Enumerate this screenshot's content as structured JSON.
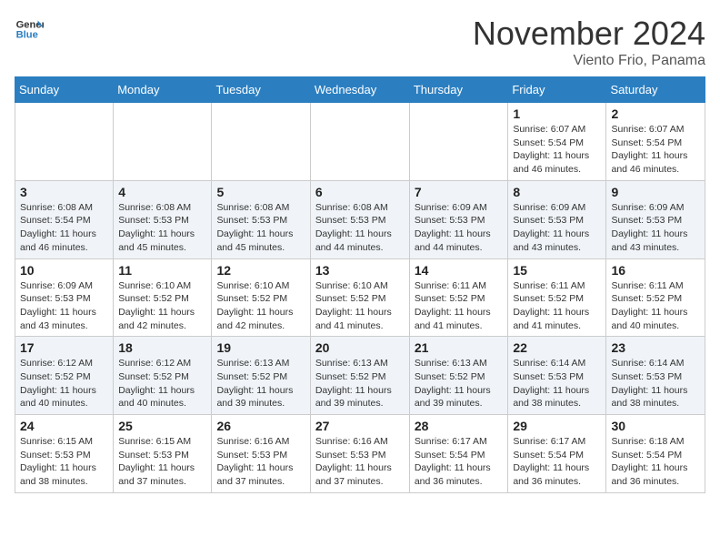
{
  "header": {
    "logo_line1": "General",
    "logo_line2": "Blue",
    "month_title": "November 2024",
    "location": "Viento Frio, Panama"
  },
  "weekdays": [
    "Sunday",
    "Monday",
    "Tuesday",
    "Wednesday",
    "Thursday",
    "Friday",
    "Saturday"
  ],
  "weeks": [
    [
      {
        "day": "",
        "info": ""
      },
      {
        "day": "",
        "info": ""
      },
      {
        "day": "",
        "info": ""
      },
      {
        "day": "",
        "info": ""
      },
      {
        "day": "",
        "info": ""
      },
      {
        "day": "1",
        "info": "Sunrise: 6:07 AM\nSunset: 5:54 PM\nDaylight: 11 hours\nand 46 minutes."
      },
      {
        "day": "2",
        "info": "Sunrise: 6:07 AM\nSunset: 5:54 PM\nDaylight: 11 hours\nand 46 minutes."
      }
    ],
    [
      {
        "day": "3",
        "info": "Sunrise: 6:08 AM\nSunset: 5:54 PM\nDaylight: 11 hours\nand 46 minutes."
      },
      {
        "day": "4",
        "info": "Sunrise: 6:08 AM\nSunset: 5:53 PM\nDaylight: 11 hours\nand 45 minutes."
      },
      {
        "day": "5",
        "info": "Sunrise: 6:08 AM\nSunset: 5:53 PM\nDaylight: 11 hours\nand 45 minutes."
      },
      {
        "day": "6",
        "info": "Sunrise: 6:08 AM\nSunset: 5:53 PM\nDaylight: 11 hours\nand 44 minutes."
      },
      {
        "day": "7",
        "info": "Sunrise: 6:09 AM\nSunset: 5:53 PM\nDaylight: 11 hours\nand 44 minutes."
      },
      {
        "day": "8",
        "info": "Sunrise: 6:09 AM\nSunset: 5:53 PM\nDaylight: 11 hours\nand 43 minutes."
      },
      {
        "day": "9",
        "info": "Sunrise: 6:09 AM\nSunset: 5:53 PM\nDaylight: 11 hours\nand 43 minutes."
      }
    ],
    [
      {
        "day": "10",
        "info": "Sunrise: 6:09 AM\nSunset: 5:53 PM\nDaylight: 11 hours\nand 43 minutes."
      },
      {
        "day": "11",
        "info": "Sunrise: 6:10 AM\nSunset: 5:52 PM\nDaylight: 11 hours\nand 42 minutes."
      },
      {
        "day": "12",
        "info": "Sunrise: 6:10 AM\nSunset: 5:52 PM\nDaylight: 11 hours\nand 42 minutes."
      },
      {
        "day": "13",
        "info": "Sunrise: 6:10 AM\nSunset: 5:52 PM\nDaylight: 11 hours\nand 41 minutes."
      },
      {
        "day": "14",
        "info": "Sunrise: 6:11 AM\nSunset: 5:52 PM\nDaylight: 11 hours\nand 41 minutes."
      },
      {
        "day": "15",
        "info": "Sunrise: 6:11 AM\nSunset: 5:52 PM\nDaylight: 11 hours\nand 41 minutes."
      },
      {
        "day": "16",
        "info": "Sunrise: 6:11 AM\nSunset: 5:52 PM\nDaylight: 11 hours\nand 40 minutes."
      }
    ],
    [
      {
        "day": "17",
        "info": "Sunrise: 6:12 AM\nSunset: 5:52 PM\nDaylight: 11 hours\nand 40 minutes."
      },
      {
        "day": "18",
        "info": "Sunrise: 6:12 AM\nSunset: 5:52 PM\nDaylight: 11 hours\nand 40 minutes."
      },
      {
        "day": "19",
        "info": "Sunrise: 6:13 AM\nSunset: 5:52 PM\nDaylight: 11 hours\nand 39 minutes."
      },
      {
        "day": "20",
        "info": "Sunrise: 6:13 AM\nSunset: 5:52 PM\nDaylight: 11 hours\nand 39 minutes."
      },
      {
        "day": "21",
        "info": "Sunrise: 6:13 AM\nSunset: 5:52 PM\nDaylight: 11 hours\nand 39 minutes."
      },
      {
        "day": "22",
        "info": "Sunrise: 6:14 AM\nSunset: 5:53 PM\nDaylight: 11 hours\nand 38 minutes."
      },
      {
        "day": "23",
        "info": "Sunrise: 6:14 AM\nSunset: 5:53 PM\nDaylight: 11 hours\nand 38 minutes."
      }
    ],
    [
      {
        "day": "24",
        "info": "Sunrise: 6:15 AM\nSunset: 5:53 PM\nDaylight: 11 hours\nand 38 minutes."
      },
      {
        "day": "25",
        "info": "Sunrise: 6:15 AM\nSunset: 5:53 PM\nDaylight: 11 hours\nand 37 minutes."
      },
      {
        "day": "26",
        "info": "Sunrise: 6:16 AM\nSunset: 5:53 PM\nDaylight: 11 hours\nand 37 minutes."
      },
      {
        "day": "27",
        "info": "Sunrise: 6:16 AM\nSunset: 5:53 PM\nDaylight: 11 hours\nand 37 minutes."
      },
      {
        "day": "28",
        "info": "Sunrise: 6:17 AM\nSunset: 5:54 PM\nDaylight: 11 hours\nand 36 minutes."
      },
      {
        "day": "29",
        "info": "Sunrise: 6:17 AM\nSunset: 5:54 PM\nDaylight: 11 hours\nand 36 minutes."
      },
      {
        "day": "30",
        "info": "Sunrise: 6:18 AM\nSunset: 5:54 PM\nDaylight: 11 hours\nand 36 minutes."
      }
    ]
  ]
}
